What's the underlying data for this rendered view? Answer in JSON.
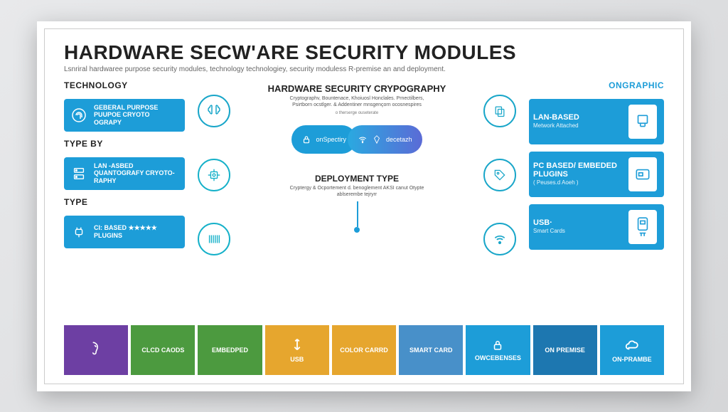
{
  "title": "HARDWARE SECW'ARE SECURITY MODULES",
  "subtitle": "Lsnriral hardwaree purpose security modules, technology technologiey, security moduless R-premise an and deployment.",
  "left": {
    "sections": [
      {
        "label": "TECHNOLOGY",
        "text": "GEBERAL PURPOSE PUUPOE CRYOTO OGRAPY",
        "icon": "fingerprint"
      },
      {
        "label": "TYPE BY",
        "text": "LAN -ASBED QUANTOGRAFY CRYOTO-RAPHY",
        "icon": "server"
      },
      {
        "label": "TYPE",
        "text": "CI: BASED ★★★★★ PLUGINS",
        "icon": "plug"
      }
    ]
  },
  "center": {
    "top_heading": "HARDWARE SECURITY CRYPOGRAPHY",
    "top_desc": "Cryptographv, Bountenace, Khoiuosl Honclales. Prnectilbers, Psirtborn ocstlger. & Addentiner mnsgençorn ocosnespires",
    "top_note": "o therserge ouseterate",
    "pill_left": "onSpectiry",
    "pill_right": "decetazh",
    "deploy_heading": "DEPLOYMENT TYPE",
    "deploy_desc": "Cryptergy & Ocportement d. benoglement AKSI canut Otypte ablserembe tejryrr"
  },
  "right": {
    "label": "ONGRAPHIC",
    "items": [
      {
        "title": "LAN-BASED",
        "sub": "Metwork Attached"
      },
      {
        "title": "PC BASED/ EMBEDED PLUGINS",
        "sub": "( Peuses.d Aoeh )"
      },
      {
        "title": "USB·",
        "sub": "Smart Cards"
      }
    ]
  },
  "bottom": [
    {
      "label": "",
      "bg": "#6d3fa3",
      "icon": "ear"
    },
    {
      "label": "CLCD CAODS",
      "bg": "#4c9a3f",
      "icon": ""
    },
    {
      "label": "EMBEDPED",
      "bg": "#4c9a3f",
      "icon": ""
    },
    {
      "label": "USB",
      "bg": "#e6a62e",
      "icon": "usb"
    },
    {
      "label": "COLOR CARRD",
      "bg": "#e6a62e",
      "icon": ""
    },
    {
      "label": "SMART CARD",
      "bg": "#4890c9",
      "icon": ""
    },
    {
      "label": "OWCEBENSES",
      "bg": "#1d9dd8",
      "icon": "lock"
    },
    {
      "label": "ON PREMISE",
      "bg": "#1d77b0",
      "icon": ""
    },
    {
      "label": "ON-PRAMBE",
      "bg": "#1d9dd8",
      "icon": "cloud"
    }
  ],
  "colors": {
    "primary": "#1d9dd8"
  }
}
